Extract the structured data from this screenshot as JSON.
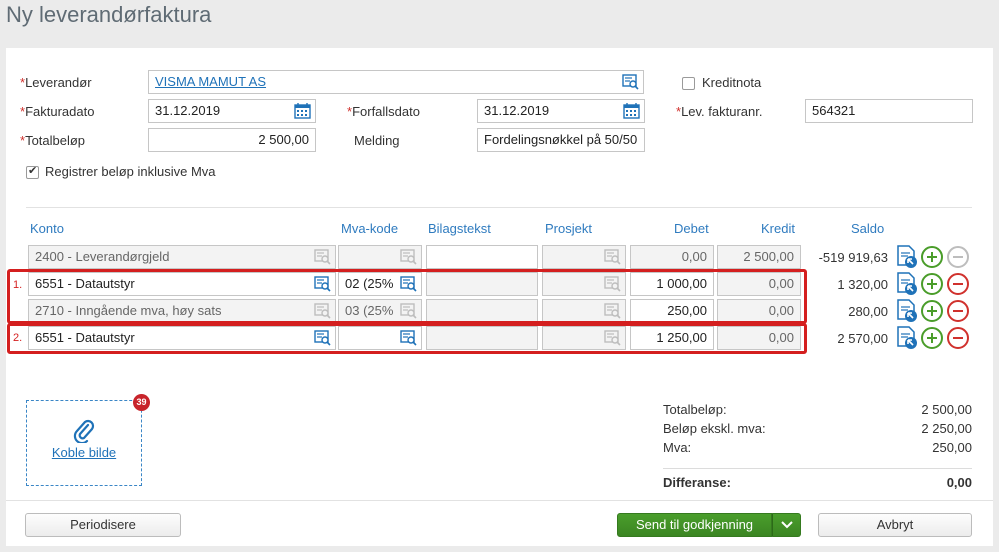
{
  "page_title": "Ny leverandørfaktura",
  "header": {
    "leverandor_label": "Leverandør",
    "leverandor_value": "VISMA MAMUT AS",
    "kreditnota_label": "Kreditnota",
    "fakturadato_label": "Fakturadato",
    "fakturadato_value": "31.12.2019",
    "forfallsdato_label": "Forfallsdato",
    "forfallsdato_value": "31.12.2019",
    "lev_fakturanr_label": "Lev. fakturanr.",
    "lev_fakturanr_value": "564321",
    "totalbelop_label": "Totalbeløp",
    "totalbelop_value": "2 500,00",
    "melding_label": "Melding",
    "melding_value": "Fordelingsnøkkel på 50/50",
    "inkl_mva_label": "Registrer beløp inklusive Mva"
  },
  "columns": {
    "konto": "Konto",
    "mva_kode": "Mva-kode",
    "bilagstekst": "Bilagstekst",
    "prosjekt": "Prosjekt",
    "debet": "Debet",
    "kredit": "Kredit",
    "saldo": "Saldo"
  },
  "rows": [
    {
      "konto": "2400 - Leverandørgjeld",
      "mva": "",
      "bilagstekst": "",
      "prosjekt": "",
      "debet": "0,00",
      "kredit": "2 500,00",
      "saldo": "-519 919,63"
    },
    {
      "konto": "6551 - Datautstyr",
      "mva": "02 (25%",
      "bilagstekst": "",
      "prosjekt": "",
      "debet": "1 000,00",
      "kredit": "0,00",
      "saldo": "1 320,00"
    },
    {
      "konto": "2710 - Inngående mva, høy sats",
      "mva": "03 (25%",
      "bilagstekst": "",
      "prosjekt": "",
      "debet": "250,00",
      "kredit": "0,00",
      "saldo": "280,00"
    },
    {
      "konto": "6551 - Datautstyr",
      "mva": "",
      "bilagstekst": "",
      "prosjekt": "",
      "debet": "1 250,00",
      "kredit": "0,00",
      "saldo": "2 570,00"
    }
  ],
  "highlights": [
    "1.",
    "2."
  ],
  "attachment": {
    "link_label": "Koble bilde",
    "badge_count": "39"
  },
  "summary": {
    "totalbelop_label": "Totalbeløp:",
    "totalbelop_value": "2 500,00",
    "eks_mva_label": "Beløp ekskl. mva:",
    "eks_mva_value": "2 250,00",
    "mva_label": "Mva:",
    "mva_value": "250,00",
    "differanse_label": "Differanse:",
    "differanse_value": "0,00"
  },
  "footer": {
    "periodisere_label": "Periodisere",
    "send_label": "Send til godkjenning",
    "avbryt_label": "Avbryt"
  },
  "colors": {
    "accent_blue": "#2f7bbf",
    "highlight_red": "#d41f1f",
    "action_green": "#3b8522"
  }
}
